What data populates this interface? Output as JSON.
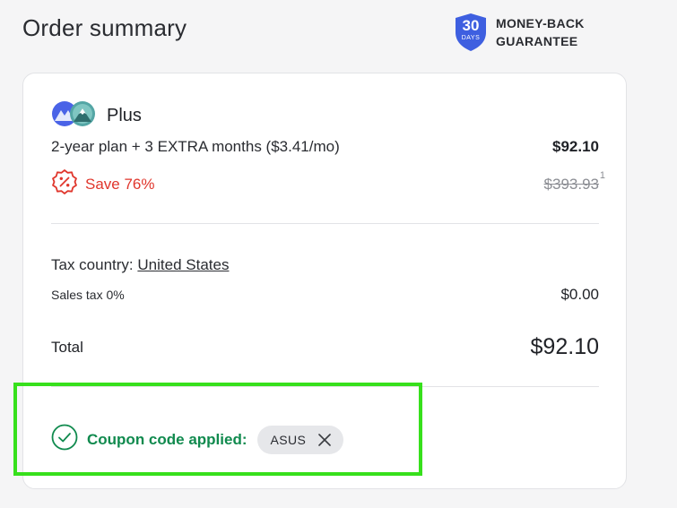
{
  "header": {
    "title": "Order summary",
    "guarantee_days": "30",
    "guarantee_days_label": "DAYS",
    "guarantee_line1": "MONEY-BACK",
    "guarantee_line2": "GUARANTEE"
  },
  "product": {
    "name": "Plus",
    "plan_description": "2-year plan + 3 EXTRA months ($3.41/mo)",
    "price": "$92.10",
    "save_label": "Save 76%",
    "original_price": "$393.93",
    "footnote": "1"
  },
  "tax": {
    "country_label": "Tax country:",
    "country_value": "United States",
    "sales_tax_label": "Sales tax 0%",
    "sales_tax_value": "$0.00"
  },
  "total": {
    "label": "Total",
    "value": "$92.10"
  },
  "coupon": {
    "applied_label": "Coupon code applied:",
    "code": "ASUS"
  },
  "colors": {
    "accent_blue": "#3e5fe0",
    "save_red": "#e0362c",
    "success_green": "#108a4e",
    "highlight_green": "#37e01c"
  },
  "icons": {
    "guarantee": "shield-badge-icon",
    "product": "product-logo-icon",
    "discount": "discount-badge-icon",
    "coupon_status": "check-circle-icon",
    "remove_coupon": "close-icon"
  }
}
